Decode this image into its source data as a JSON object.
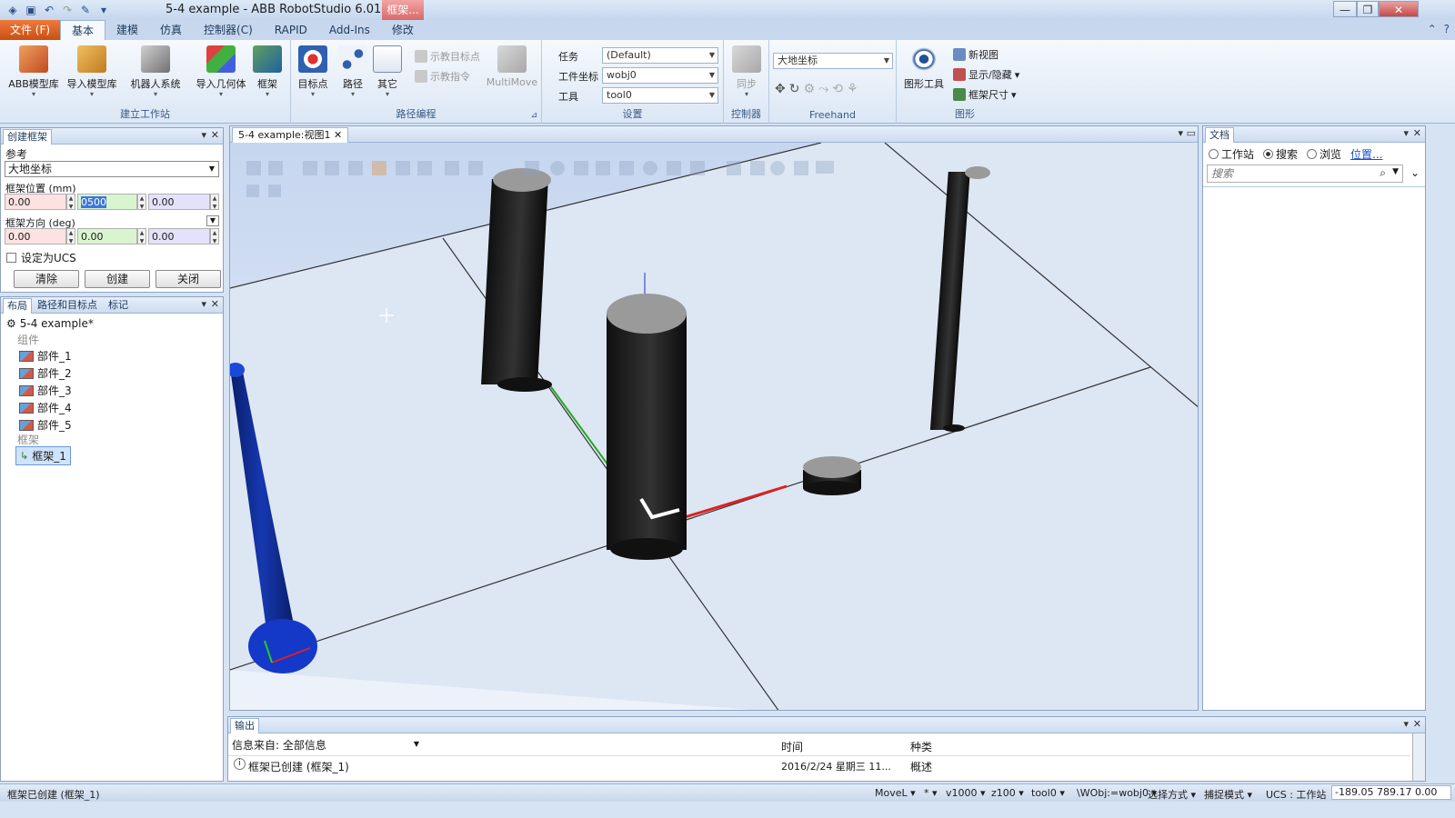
{
  "window": {
    "title": "5-4 example - ABB RobotStudio 6.01.01",
    "context_tab": "框架...",
    "controls": [
      "—",
      "❐",
      "✕"
    ]
  },
  "ribbon": {
    "file_tab": "文件 (F)",
    "tabs": [
      "基本",
      "建模",
      "仿真",
      "控制器(C)",
      "RAPID",
      "Add-Ins",
      "修改"
    ],
    "active_tab": "基本",
    "groups": {
      "build_station": {
        "label": "建立工作站",
        "buttons": [
          "ABB模型库",
          "导入模型库",
          "机器人系统",
          "导入几何体",
          "框架"
        ]
      },
      "path_programming": {
        "label": "路径编程",
        "buttons": [
          "目标点",
          "路径",
          "其它"
        ],
        "small": [
          "示教目标点",
          "示教指令"
        ],
        "multimove": "MultiMove"
      },
      "settings": {
        "label": "设置",
        "task_label": "任务",
        "task_value": "(Default)",
        "wobj_label": "工件坐标",
        "wobj_value": "wobj0",
        "tool_label": "工具",
        "tool_value": "tool0"
      },
      "controller": {
        "label": "控制器",
        "sync": "同步"
      },
      "freehand": {
        "label": "Freehand",
        "ref_value": "大地坐标"
      },
      "graphics": {
        "label": "图形",
        "graphics_tool": "图形工具",
        "new_view": "新视图",
        "show_hide": "显示/隐藏",
        "frame_size": "框架尺寸"
      }
    }
  },
  "create_frame": {
    "title": "创建框架",
    "reference_label": "参考",
    "reference_value": "大地坐标",
    "position_label": "框架位置 (mm)",
    "position": [
      "0.00",
      "0500",
      "0.00"
    ],
    "orientation_label": "框架方向 (deg)",
    "orientation": [
      "0.00",
      "0.00",
      "0.00"
    ],
    "ucs_label": "设定为UCS",
    "buttons": {
      "clear": "清除",
      "create": "创建",
      "close": "关闭"
    }
  },
  "layout_panel": {
    "tabs": [
      "布局",
      "路径和目标点",
      "标记"
    ],
    "root": "5-4 example*",
    "components_label": "组件",
    "parts": [
      "部件_1",
      "部件_2",
      "部件_3",
      "部件_4",
      "部件_5"
    ],
    "frames_label": "框架",
    "frames": [
      "框架_1"
    ]
  },
  "viewport": {
    "tab": "5-4 example:视图1"
  },
  "docs_panel": {
    "title": "文档",
    "radio_station": "工作站",
    "radio_search": "搜索",
    "radio_browse": "浏览",
    "location_link": "位置...",
    "search_placeholder": "搜索"
  },
  "output": {
    "title": "输出",
    "source_label": "信息来自: 全部信息",
    "col_time": "时间",
    "col_kind": "种类",
    "rows": [
      {
        "message": "框架已创建 (框架_1)",
        "time": "2016/2/24 星期三 11...",
        "kind": "概述"
      }
    ]
  },
  "status": {
    "message": "框架已创建 (框架_1)",
    "move": "MoveL ▾",
    "star": "* ▾",
    "speed": "v1000 ▾",
    "zone": "z100 ▾",
    "tool": "tool0 ▾",
    "wobj": "\\WObj:=wobj0 ▾",
    "select_mode": "选择方式 ▾",
    "snap_mode": "捕捉模式 ▾",
    "ucs": "UCS : 工作站",
    "coords": "-189.05  789.17  0.00"
  },
  "colors": {
    "ribbon_accent": "#c94f12",
    "floor": "#dfe8f4",
    "cylinder": "#222222",
    "cylinder_top": "#9b9b9b",
    "robot_base": "#0a2a8a",
    "axis_x": "#e02020",
    "axis_y": "#20c020",
    "axis_z": "#2020e0"
  }
}
